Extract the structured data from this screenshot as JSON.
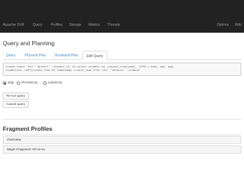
{
  "navbar": {
    "brand": "Apache Drill",
    "items": [
      "Query",
      "Profiles",
      "Storage",
      "Metrics",
      "Threads"
    ],
    "right_items": [
      "Options",
      "Wiki"
    ]
  },
  "page": {
    "title": "Query and Planning"
  },
  "tabs": [
    {
      "label": "Query",
      "active": false
    },
    {
      "label": "Physical Plan",
      "active": false
    },
    {
      "label": "Visualized Plan",
      "active": false
    },
    {
      "label": "Edit Query",
      "active": true
    }
  ],
  "query": {
    "line1": "create table `dfs`.`default`.`student_rm` as select student_id, convert_from(name, 'UTF8') name, age, gpa,",
    "line2": "studentnum, CAST(create_time AS timestamp) create_time from `dfs`.`default`.`student`"
  },
  "query_type": {
    "options": [
      "SQL",
      "PHYSICAL",
      "LOGICAL"
    ],
    "selected": "SQL"
  },
  "buttons": {
    "rerun": "Re-run query",
    "cancel": "Cancel query"
  },
  "fragments": {
    "title": "Fragment Profiles",
    "overview_label": "Overview",
    "major_fragment_label": "Major Fragment: 00-xx-xx"
  }
}
